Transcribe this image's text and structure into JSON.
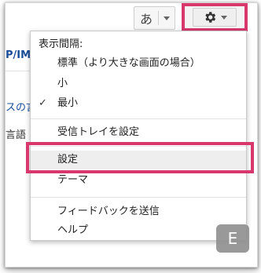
{
  "toolbar": {
    "ime_label": "あ",
    "ime_dropdown_icon": "triangle-down",
    "settings_icon": "gear",
    "settings_dropdown_icon": "triangle-down"
  },
  "background": {
    "fragment_1": "P/IMA",
    "fragment_2": "スの言",
    "fragment_3": "言語"
  },
  "menu": {
    "heading": "表示間隔:",
    "density_options": [
      {
        "label": "標準（より大きな画面の場合）",
        "checked": false
      },
      {
        "label": "小",
        "checked": false
      },
      {
        "label": "最小",
        "checked": true
      }
    ],
    "check_mark": "✓",
    "configure_inbox": "受信トレイを設定",
    "settings": "設定",
    "themes": "テーマ",
    "send_feedback": "フィードバックを送信",
    "help": "ヘルプ"
  },
  "badge": {
    "label": "E"
  },
  "colors": {
    "highlight": "#d8386c",
    "link": "#1a4d99"
  }
}
